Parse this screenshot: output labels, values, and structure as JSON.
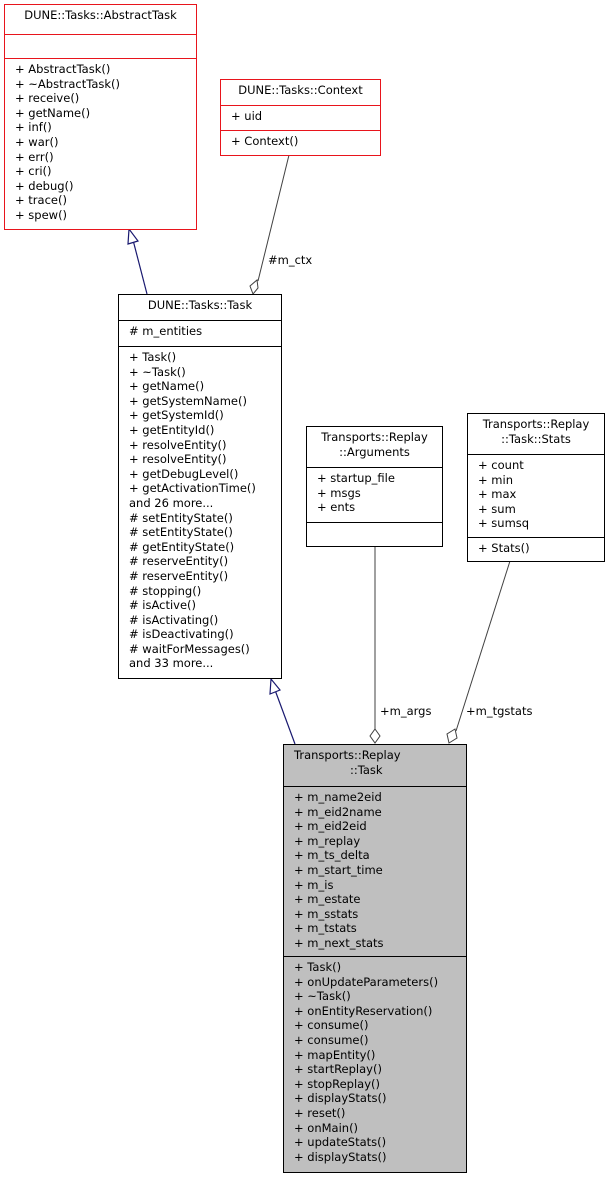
{
  "diagram": {
    "classes": {
      "abstract_task": {
        "title": [
          "DUNE::Tasks::AbstractTask"
        ],
        "attributes": [],
        "methods": [
          "+ AbstractTask()",
          "+ ~AbstractTask()",
          "+ receive()",
          "+ getName()",
          "+ inf()",
          "+ war()",
          "+ err()",
          "+ cri()",
          "+ debug()",
          "+ trace()",
          "+ spew()"
        ],
        "border_color": "#e8141c"
      },
      "context": {
        "title": [
          "DUNE::Tasks::Context"
        ],
        "attributes": [
          "+ uid"
        ],
        "methods": [
          "+ Context()"
        ],
        "border_color": "#e8141c"
      },
      "task": {
        "title": [
          "DUNE::Tasks::Task"
        ],
        "attributes": [
          "# m_entities"
        ],
        "methods": [
          "+ Task()",
          "+ ~Task()",
          "+ getName()",
          "+ getSystemName()",
          "+ getSystemId()",
          "+ getEntityId()",
          "+ resolveEntity()",
          "+ resolveEntity()",
          "+ getDebugLevel()",
          "+ getActivationTime()",
          "and 26 more...",
          "# setEntityState()",
          "# setEntityState()",
          "# getEntityState()",
          "# reserveEntity()",
          "# reserveEntity()",
          "# stopping()",
          "# isActive()",
          "# isActivating()",
          "# isDeactivating()",
          "# waitForMessages()",
          "and 33 more..."
        ],
        "border_color": "#000000"
      },
      "arguments": {
        "title": [
          "Transports::Replay",
          "::Arguments"
        ],
        "attributes": [
          "+ startup_file",
          "+ msgs",
          "+ ents"
        ],
        "methods": [],
        "border_color": "#000000"
      },
      "stats": {
        "title": [
          "Transports::Replay",
          "::Task::Stats"
        ],
        "attributes": [
          "+ count",
          "+ min",
          "+ max",
          "+ sum",
          "+ sumsq"
        ],
        "methods": [
          "+ Stats()"
        ],
        "border_color": "#000000"
      },
      "replay_task": {
        "title": [
          "Transports::Replay",
          "::Task"
        ],
        "attributes": [
          "+ m_name2eid",
          "+ m_eid2name",
          "+ m_eid2eid",
          "+ m_replay",
          "+ m_ts_delta",
          "+ m_start_time",
          "+ m_is",
          "+ m_estate",
          "+ m_sstats",
          "+ m_tstats",
          "+ m_next_stats"
        ],
        "methods": [
          "+ Task()",
          "+ onUpdateParameters()",
          "+ ~Task()",
          "+ onEntityReservation()",
          "+ consume()",
          "+ consume()",
          "+ mapEntity()",
          "+ startReplay()",
          "+ stopReplay()",
          "+ displayStats()",
          "+ reset()",
          "+ onMain()",
          "+ updateStats()",
          "+ displayStats()"
        ],
        "fill_color": "#bfbfbf"
      }
    },
    "edges": {
      "inheritance_color": "#191970",
      "association_color": "#404040",
      "labels": {
        "ctx": "#m_ctx",
        "args": "+m_args",
        "tgstats": "+m_tgstats"
      }
    }
  }
}
